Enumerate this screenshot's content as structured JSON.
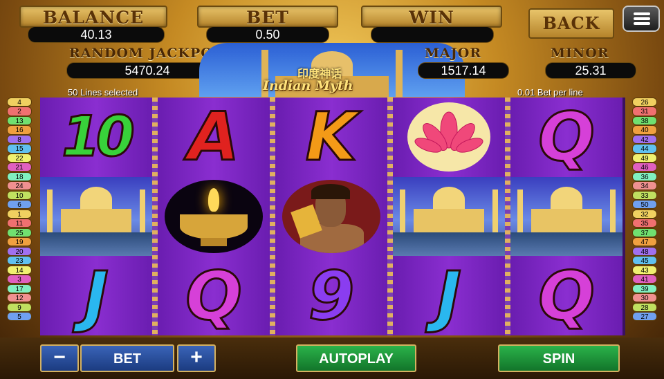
{
  "header": {
    "balance_label": "BALANCE",
    "balance_value": "40.13",
    "bet_label": "BET",
    "bet_value": "0.50",
    "win_label": "WIN",
    "win_value": "",
    "back_label": "BACK",
    "menu_icon": "hamburger-menu-icon"
  },
  "jackpots": {
    "random_label": "RANDOM JACKPOT",
    "random_value": "5470.24",
    "major_label": "MAJOR",
    "major_value": "1517.14",
    "minor_label": "MINOR",
    "minor_value": "25.31"
  },
  "title": {
    "chinese": "印度神话",
    "english": "Indian Myth"
  },
  "info": {
    "lines_selected": "50 Lines selected",
    "bet_per_line": "0.01 Bet per line"
  },
  "reels": [
    [
      "10",
      "taj-mahal",
      "J"
    ],
    [
      "A",
      "oil-lamp",
      "Q"
    ],
    [
      "K",
      "warrior",
      "9"
    ],
    [
      "lotus",
      "taj-mahal",
      "J"
    ],
    [
      "Q",
      "taj-mahal",
      "Q"
    ]
  ],
  "left_lines": [
    "4",
    "2",
    "13",
    "16",
    "8",
    "15",
    "22",
    "21",
    "18",
    "24",
    "10",
    "6",
    "1",
    "11",
    "25",
    "19",
    "20",
    "23",
    "14",
    "3",
    "17",
    "12",
    "9",
    "5"
  ],
  "right_lines": [
    "26",
    "31",
    "38",
    "40",
    "42",
    "44",
    "49",
    "46",
    "36",
    "34",
    "33",
    "50",
    "32",
    "35",
    "37",
    "47",
    "48",
    "45",
    "43",
    "41",
    "39",
    "30",
    "28",
    "27"
  ],
  "line_colors": [
    "#f0d060",
    "#f07070",
    "#70e070",
    "#f0a040",
    "#a070f0",
    "#60c0f0",
    "#f0f070",
    "#e060c0",
    "#80f0c0",
    "#f09090",
    "#c0e060",
    "#70a0f0"
  ],
  "controls": {
    "minus_label": "−",
    "bet_label": "BET",
    "plus_label": "+",
    "autoplay_label": "AUTOPLAY",
    "spin_label": "SPIN"
  }
}
